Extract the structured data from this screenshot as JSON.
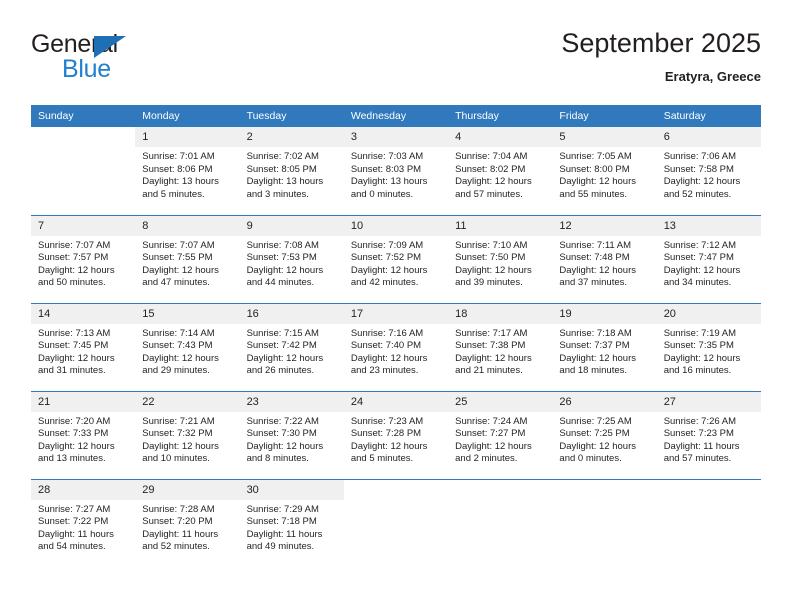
{
  "brand": {
    "name_part1": "General",
    "name_part2": "Blue",
    "accent_color": "#1f7fd0",
    "triangle_color": "#1f6fb4"
  },
  "header": {
    "title": "September 2025",
    "subtitle": "Eratyra, Greece"
  },
  "calendar": {
    "header_bg": "#3079bd",
    "daynum_bg": "#f0f0f0",
    "weekdays": [
      "Sunday",
      "Monday",
      "Tuesday",
      "Wednesday",
      "Thursday",
      "Friday",
      "Saturday"
    ],
    "weeks": [
      [
        {
          "day": ""
        },
        {
          "day": "1",
          "sunrise": "Sunrise: 7:01 AM",
          "sunset": "Sunset: 8:06 PM",
          "daylight": "Daylight: 13 hours and 5 minutes."
        },
        {
          "day": "2",
          "sunrise": "Sunrise: 7:02 AM",
          "sunset": "Sunset: 8:05 PM",
          "daylight": "Daylight: 13 hours and 3 minutes."
        },
        {
          "day": "3",
          "sunrise": "Sunrise: 7:03 AM",
          "sunset": "Sunset: 8:03 PM",
          "daylight": "Daylight: 13 hours and 0 minutes."
        },
        {
          "day": "4",
          "sunrise": "Sunrise: 7:04 AM",
          "sunset": "Sunset: 8:02 PM",
          "daylight": "Daylight: 12 hours and 57 minutes."
        },
        {
          "day": "5",
          "sunrise": "Sunrise: 7:05 AM",
          "sunset": "Sunset: 8:00 PM",
          "daylight": "Daylight: 12 hours and 55 minutes."
        },
        {
          "day": "6",
          "sunrise": "Sunrise: 7:06 AM",
          "sunset": "Sunset: 7:58 PM",
          "daylight": "Daylight: 12 hours and 52 minutes."
        }
      ],
      [
        {
          "day": "7",
          "sunrise": "Sunrise: 7:07 AM",
          "sunset": "Sunset: 7:57 PM",
          "daylight": "Daylight: 12 hours and 50 minutes."
        },
        {
          "day": "8",
          "sunrise": "Sunrise: 7:07 AM",
          "sunset": "Sunset: 7:55 PM",
          "daylight": "Daylight: 12 hours and 47 minutes."
        },
        {
          "day": "9",
          "sunrise": "Sunrise: 7:08 AM",
          "sunset": "Sunset: 7:53 PM",
          "daylight": "Daylight: 12 hours and 44 minutes."
        },
        {
          "day": "10",
          "sunrise": "Sunrise: 7:09 AM",
          "sunset": "Sunset: 7:52 PM",
          "daylight": "Daylight: 12 hours and 42 minutes."
        },
        {
          "day": "11",
          "sunrise": "Sunrise: 7:10 AM",
          "sunset": "Sunset: 7:50 PM",
          "daylight": "Daylight: 12 hours and 39 minutes."
        },
        {
          "day": "12",
          "sunrise": "Sunrise: 7:11 AM",
          "sunset": "Sunset: 7:48 PM",
          "daylight": "Daylight: 12 hours and 37 minutes."
        },
        {
          "day": "13",
          "sunrise": "Sunrise: 7:12 AM",
          "sunset": "Sunset: 7:47 PM",
          "daylight": "Daylight: 12 hours and 34 minutes."
        }
      ],
      [
        {
          "day": "14",
          "sunrise": "Sunrise: 7:13 AM",
          "sunset": "Sunset: 7:45 PM",
          "daylight": "Daylight: 12 hours and 31 minutes."
        },
        {
          "day": "15",
          "sunrise": "Sunrise: 7:14 AM",
          "sunset": "Sunset: 7:43 PM",
          "daylight": "Daylight: 12 hours and 29 minutes."
        },
        {
          "day": "16",
          "sunrise": "Sunrise: 7:15 AM",
          "sunset": "Sunset: 7:42 PM",
          "daylight": "Daylight: 12 hours and 26 minutes."
        },
        {
          "day": "17",
          "sunrise": "Sunrise: 7:16 AM",
          "sunset": "Sunset: 7:40 PM",
          "daylight": "Daylight: 12 hours and 23 minutes."
        },
        {
          "day": "18",
          "sunrise": "Sunrise: 7:17 AM",
          "sunset": "Sunset: 7:38 PM",
          "daylight": "Daylight: 12 hours and 21 minutes."
        },
        {
          "day": "19",
          "sunrise": "Sunrise: 7:18 AM",
          "sunset": "Sunset: 7:37 PM",
          "daylight": "Daylight: 12 hours and 18 minutes."
        },
        {
          "day": "20",
          "sunrise": "Sunrise: 7:19 AM",
          "sunset": "Sunset: 7:35 PM",
          "daylight": "Daylight: 12 hours and 16 minutes."
        }
      ],
      [
        {
          "day": "21",
          "sunrise": "Sunrise: 7:20 AM",
          "sunset": "Sunset: 7:33 PM",
          "daylight": "Daylight: 12 hours and 13 minutes."
        },
        {
          "day": "22",
          "sunrise": "Sunrise: 7:21 AM",
          "sunset": "Sunset: 7:32 PM",
          "daylight": "Daylight: 12 hours and 10 minutes."
        },
        {
          "day": "23",
          "sunrise": "Sunrise: 7:22 AM",
          "sunset": "Sunset: 7:30 PM",
          "daylight": "Daylight: 12 hours and 8 minutes."
        },
        {
          "day": "24",
          "sunrise": "Sunrise: 7:23 AM",
          "sunset": "Sunset: 7:28 PM",
          "daylight": "Daylight: 12 hours and 5 minutes."
        },
        {
          "day": "25",
          "sunrise": "Sunrise: 7:24 AM",
          "sunset": "Sunset: 7:27 PM",
          "daylight": "Daylight: 12 hours and 2 minutes."
        },
        {
          "day": "26",
          "sunrise": "Sunrise: 7:25 AM",
          "sunset": "Sunset: 7:25 PM",
          "daylight": "Daylight: 12 hours and 0 minutes."
        },
        {
          "day": "27",
          "sunrise": "Sunrise: 7:26 AM",
          "sunset": "Sunset: 7:23 PM",
          "daylight": "Daylight: 11 hours and 57 minutes."
        }
      ],
      [
        {
          "day": "28",
          "sunrise": "Sunrise: 7:27 AM",
          "sunset": "Sunset: 7:22 PM",
          "daylight": "Daylight: 11 hours and 54 minutes."
        },
        {
          "day": "29",
          "sunrise": "Sunrise: 7:28 AM",
          "sunset": "Sunset: 7:20 PM",
          "daylight": "Daylight: 11 hours and 52 minutes."
        },
        {
          "day": "30",
          "sunrise": "Sunrise: 7:29 AM",
          "sunset": "Sunset: 7:18 PM",
          "daylight": "Daylight: 11 hours and 49 minutes."
        },
        {
          "day": ""
        },
        {
          "day": ""
        },
        {
          "day": ""
        },
        {
          "day": ""
        }
      ]
    ]
  }
}
